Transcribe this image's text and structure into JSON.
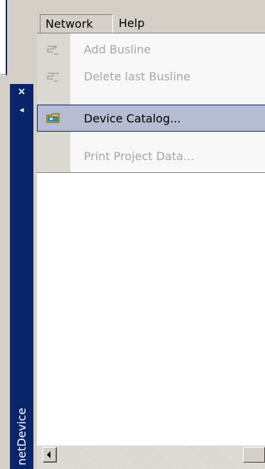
{
  "side_panel": {
    "title": "netDevice",
    "close_glyph": "×",
    "arrow_glyph": "◂"
  },
  "menubar": {
    "items": [
      {
        "label": "Network",
        "active": true
      },
      {
        "label": "Help",
        "active": false
      }
    ]
  },
  "network_menu": {
    "items": [
      {
        "label": "Add Busline",
        "icon": "add-busline-icon",
        "enabled": false
      },
      {
        "label": "Delete last Busline",
        "icon": "delete-busline-icon",
        "enabled": false
      },
      {
        "label": "Device Catalog...",
        "icon": "device-catalog-folder-icon",
        "enabled": true,
        "highlighted": true
      },
      {
        "label": "Print Project Data...",
        "icon": null,
        "enabled": false
      }
    ]
  },
  "colors": {
    "panel_blue": "#0a246a",
    "highlight": "#b6bdd2",
    "disabled_text": "#a8a6a0"
  }
}
